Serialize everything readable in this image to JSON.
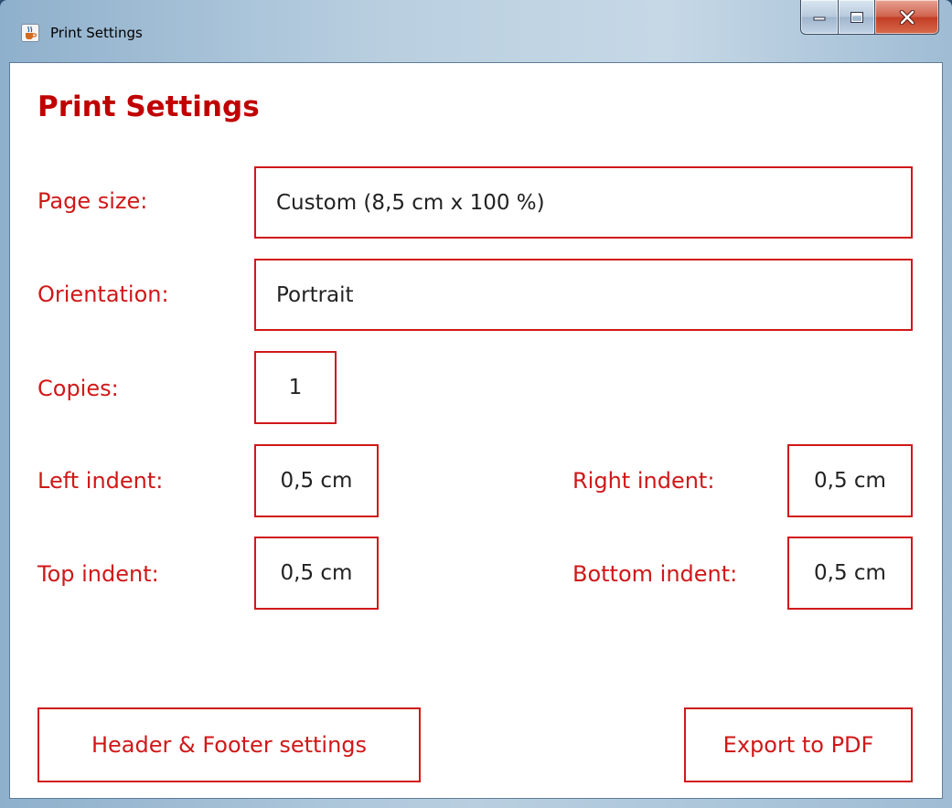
{
  "window": {
    "title": "Print Settings",
    "icon": "java-cup-icon",
    "controls": [
      "minimize-icon",
      "maximize-icon",
      "close-icon"
    ]
  },
  "heading": "Print Settings",
  "fields": {
    "page_size": {
      "label": "Page size:",
      "value": "Custom (8,5 cm x 100 %)"
    },
    "orientation": {
      "label": "Orientation:",
      "value": "Portrait"
    },
    "copies": {
      "label": "Copies:",
      "value": "1"
    },
    "left_indent": {
      "label": "Left indent:",
      "value": "0,5 cm"
    },
    "right_indent": {
      "label": "Right indent:",
      "value": "0,5 cm"
    },
    "top_indent": {
      "label": "Top indent:",
      "value": "0,5 cm"
    },
    "bottom_indent": {
      "label": "Bottom indent:",
      "value": "0,5 cm"
    }
  },
  "buttons": {
    "header_footer": "Header & Footer settings",
    "export_pdf": "Export to PDF"
  },
  "colors": {
    "accent": "#d01818",
    "heading": "#c00000"
  }
}
